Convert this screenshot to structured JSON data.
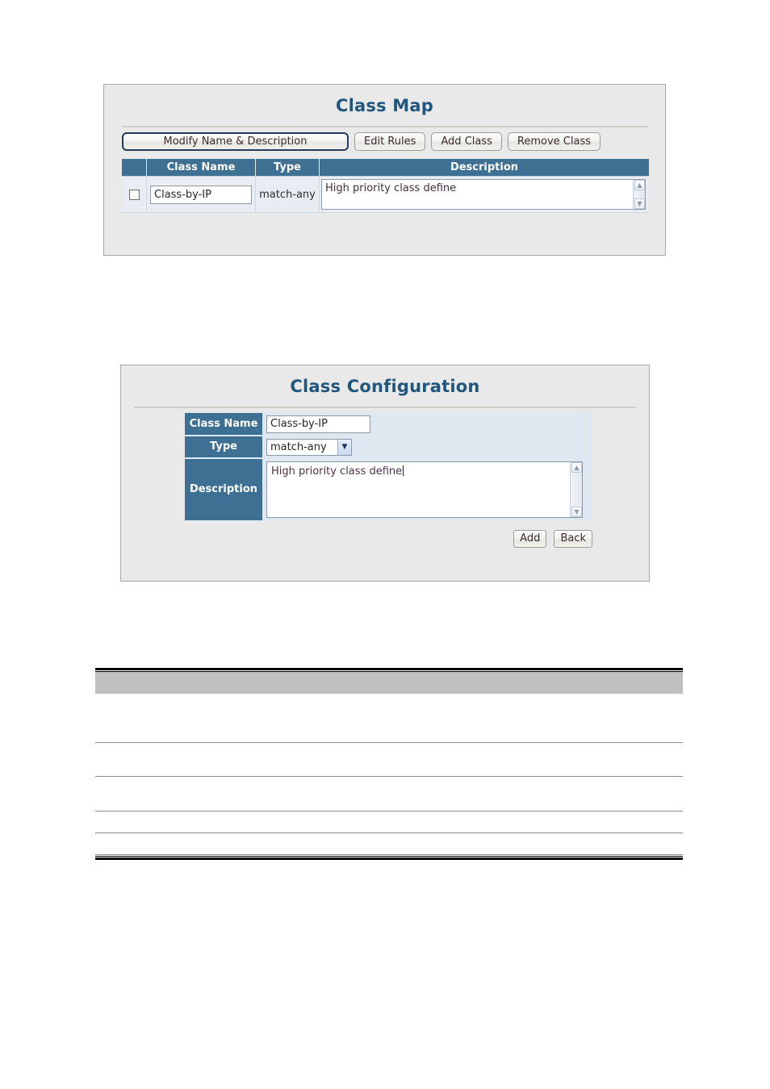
{
  "class_map_panel": {
    "title": "Class Map",
    "toolbar": {
      "modify_label": "Modify Name & Description",
      "edit_rules_label": "Edit Rules",
      "add_class_label": "Add Class",
      "remove_class_label": "Remove Class"
    },
    "table": {
      "columns": [
        "",
        "Class Name",
        "Type",
        "Description"
      ],
      "rows": [
        {
          "selected": false,
          "class_name": "Class-by-IP",
          "type": "match-any",
          "description": "High priority class define"
        }
      ]
    }
  },
  "class_config_panel": {
    "title": "Class Configuration",
    "fields": {
      "class_name_label": "Class Name",
      "class_name_value": "Class-by-IP",
      "type_label": "Type",
      "type_value": "match-any",
      "description_label": "Description",
      "description_value": "High priority class define"
    },
    "actions": {
      "add_label": "Add",
      "back_label": "Back"
    }
  },
  "bottom_table": {
    "header_cells": [
      "",
      ""
    ],
    "rows": [
      {
        "cells": [
          "",
          ""
        ]
      },
      {
        "cells": [
          "",
          ""
        ]
      },
      {
        "cells": [
          "",
          ""
        ]
      },
      {
        "cells": [
          "",
          ""
        ]
      },
      {
        "cells": [
          "",
          ""
        ]
      }
    ]
  },
  "icons": {
    "scroll_up": "▲",
    "scroll_down": "▼",
    "select_chevron": "▼"
  },
  "colors": {
    "panel_bg": "#e9e9e9",
    "title_blue": "#21577d",
    "header_blue": "#3e7094",
    "field_bg": "#dfe7f0",
    "bottom_header_gray": "#c0c0c0"
  }
}
